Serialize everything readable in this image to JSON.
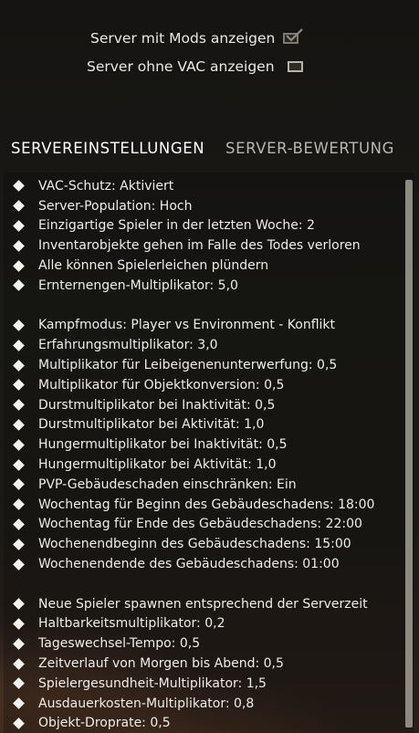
{
  "filters": {
    "show_modded": {
      "label": "Server mit Mods anzeigen",
      "checked": true
    },
    "show_no_vac": {
      "label": "Server ohne VAC anzeigen",
      "checked": false
    }
  },
  "tabs": [
    {
      "label": "SERVEREINSTELLUNGEN",
      "active": true
    },
    {
      "label": "SERVER-BEWERTUNG",
      "active": false
    }
  ],
  "settings": [
    {
      "text": "VAC-Schutz: Aktiviert"
    },
    {
      "text": "Server-Population: Hoch"
    },
    {
      "text": "Einzigartige Spieler in der letzten Woche: 2"
    },
    {
      "text": "Inventarobjekte gehen im Falle des Todes verloren"
    },
    {
      "text": "Alle können Spielerleichen plündern"
    },
    {
      "text": "Ernternengen-Multiplikator: 5,0"
    },
    {
      "spacer": true
    },
    {
      "text": "Kampfmodus: Player vs Environment - Konflikt"
    },
    {
      "text": "Erfahrungsmultiplikator: 3,0"
    },
    {
      "text": "Multiplikator für Leibeigenenunterwerfung: 0,5"
    },
    {
      "text": "Multiplikator für Objektkonversion: 0,5"
    },
    {
      "text": "Durstmultiplikator bei Inaktivität: 0,5"
    },
    {
      "text": "Durstmultiplikator bei Aktivität: 1,0"
    },
    {
      "text": "Hungermultiplikator bei Inaktivität: 0,5"
    },
    {
      "text": "Hungermultiplikator bei Aktivität: 1,0"
    },
    {
      "text": "PVP-Gebäudeschaden einschränken: Ein"
    },
    {
      "text": "Wochentag für Beginn des Gebäudeschadens: 18:00"
    },
    {
      "text": "Wochentag für Ende des Gebäudeschadens: 22:00"
    },
    {
      "text": "Wochenendbeginn des Gebäudeschadens: 15:00"
    },
    {
      "text": "Wochenendende des Gebäudeschadens: 01:00"
    },
    {
      "spacer": true
    },
    {
      "text": "Neue Spieler spawnen entsprechend der Serverzeit"
    },
    {
      "text": "Haltbarkeitsmultiplikator: 0,2"
    },
    {
      "text": "Tageswechsel-Tempo: 0,5"
    },
    {
      "text": "Zeitverlauf von Morgen bis Abend: 0,5"
    },
    {
      "text": "Spielergesundheit-Multiplikator: 1,5"
    },
    {
      "text": "Ausdauerkosten-Multiplikator: 0,8"
    },
    {
      "text": "Objekt-Droprate: 0,5"
    }
  ],
  "icons": {
    "bullet": "diamond-bullet-icon",
    "check": "checkmark-icon"
  },
  "colors": {
    "text": "#eeede8",
    "inactive_tab": "#b9b6ad",
    "scrollbar": "#8d8a82"
  }
}
